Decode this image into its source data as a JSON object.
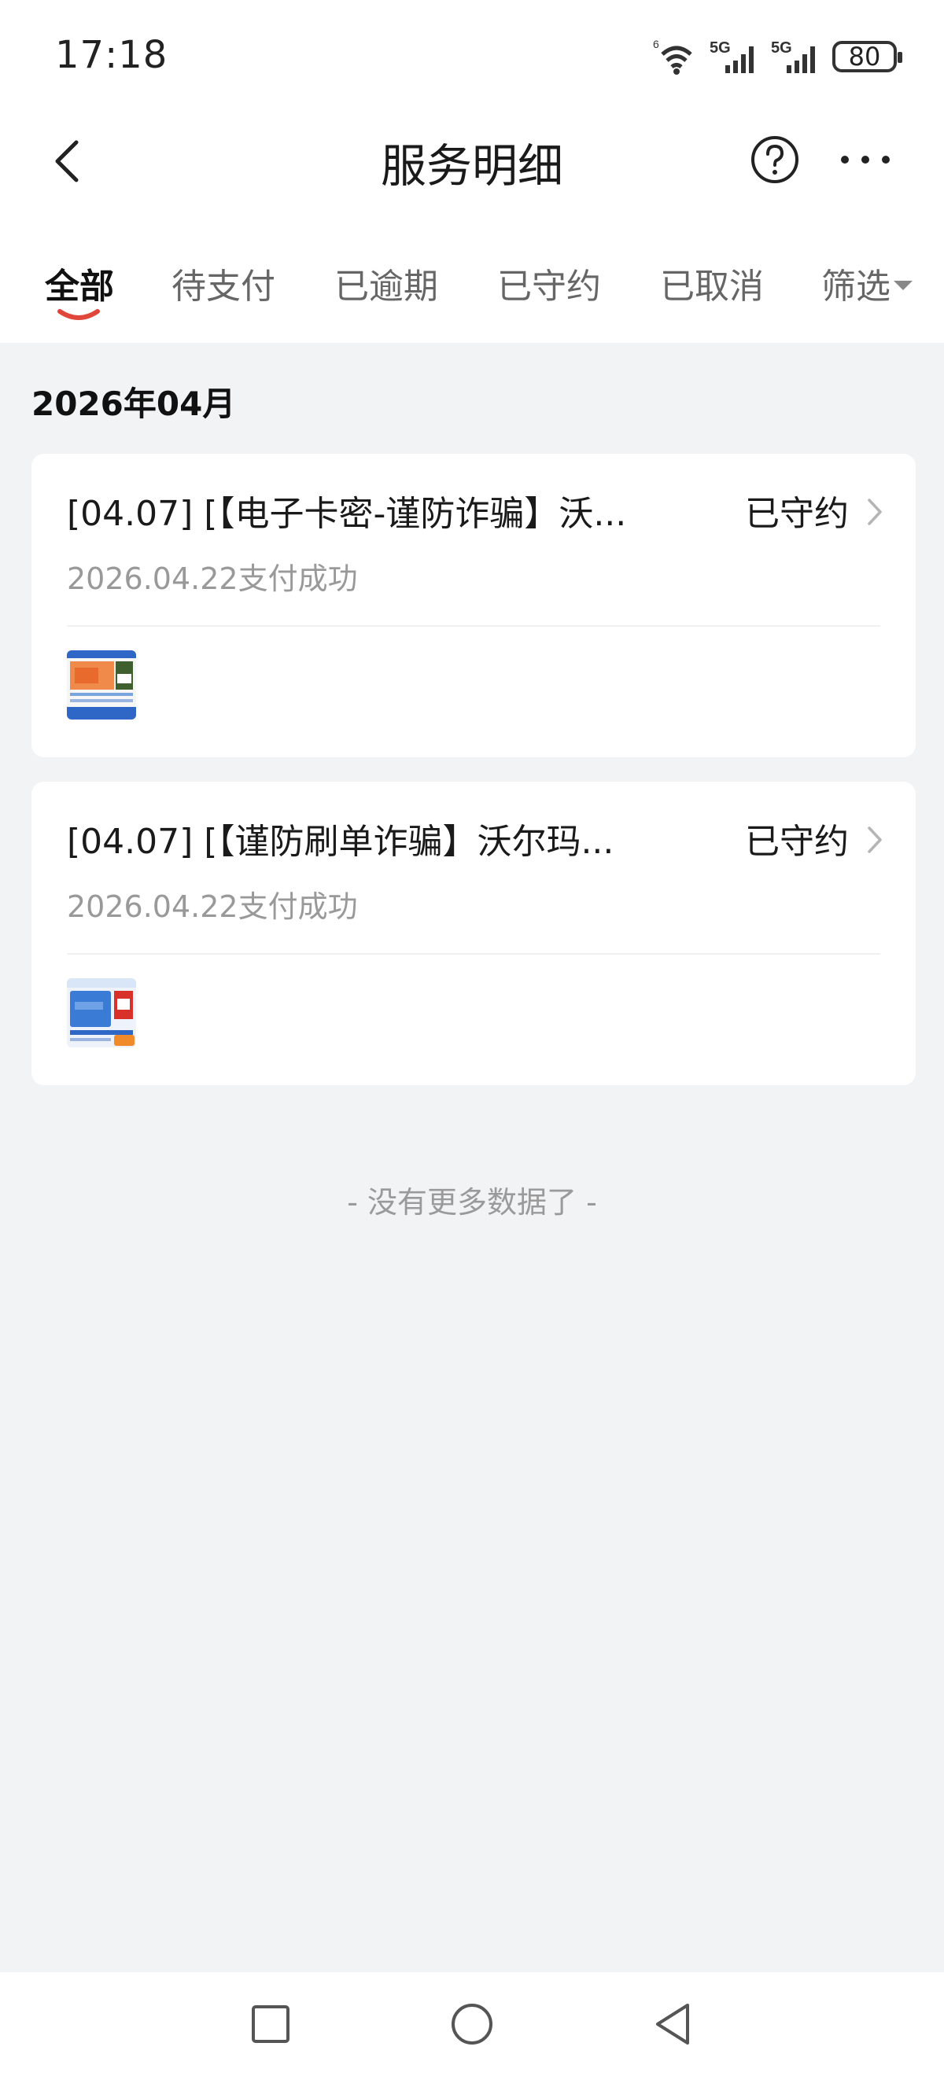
{
  "status_bar": {
    "time": "17:18",
    "wifi_badge": "6",
    "network_1": "5G",
    "network_2": "5G",
    "battery": "80"
  },
  "header": {
    "title": "服务明细",
    "back_icon": "chevron-left-icon",
    "help_icon": "question-circle-icon",
    "more_icon": "more-dots-icon"
  },
  "tabs": [
    {
      "label": "全部",
      "active": true
    },
    {
      "label": "待支付",
      "active": false
    },
    {
      "label": "已逾期",
      "active": false
    },
    {
      "label": "已守约",
      "active": false
    },
    {
      "label": "已取消",
      "active": false
    }
  ],
  "filter": {
    "label": "筛选"
  },
  "month_label": "2026年04月",
  "orders": [
    {
      "title": "[04.07] [【电子卡密-谨防诈骗】沃...",
      "status": "已守约",
      "subtitle": "2026.04.22支付成功"
    },
    {
      "title": "[04.07] [【谨防刷单诈骗】沃尔玛...",
      "status": "已守约",
      "subtitle": "2026.04.22支付成功"
    }
  ],
  "footer_text": "- 没有更多数据了 -",
  "colors": {
    "accent": "#e0463a",
    "background": "#f2f3f5",
    "card": "#ffffff",
    "muted_text": "#999999"
  }
}
